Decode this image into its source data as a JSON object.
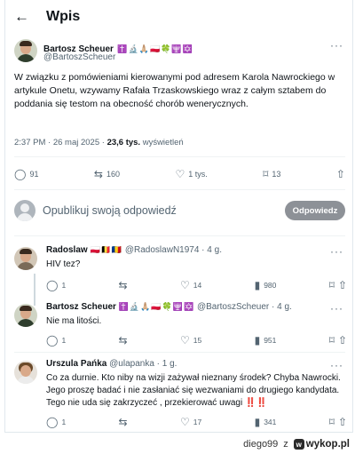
{
  "header": {
    "back_icon": "arrow-left-icon",
    "title": "Wpis"
  },
  "main_post": {
    "author_name": "Bartosz Scheuer",
    "author_emoji": "✝️🔬🙏🏼🇵🇱🍀🕎✡️",
    "author_handle": "@BartoszScheuer",
    "text": "W związku z pomówieniami kierowanymi pod adresem Karola Nawrockiego w artykule Onetu, wzywamy Rafała Trzaskowskiego wraz z całym sztabem do poddania się testom na obecność chorób wenerycznych.",
    "time": "2:37 PM · 26 maj 2025 · ",
    "views_count": "23,6 tys.",
    "views_label": " wyświetleń",
    "stats": {
      "replies": "91",
      "retweets": "160",
      "likes": "1 tys.",
      "bookmarks": "13"
    }
  },
  "reply_box": {
    "placeholder": "Opublikuj swoją odpowiedź",
    "button": "Odpowiedz"
  },
  "replies": [
    {
      "name": "Radoslaw",
      "emoji": "🇵🇱🇧🇪🇷🇴",
      "handle": "@RadoslawN1974 · 4 g.",
      "text": "HIV tez?",
      "replies": "1",
      "retweets": "",
      "likes": "14",
      "views": "980"
    },
    {
      "name": "Bartosz Scheuer",
      "emoji": "✝️🔬🙏🏼🇵🇱🍀🕎✡️",
      "handle": "@BartoszScheuer · 4 g.",
      "text": "Nie ma litości.",
      "replies": "1",
      "retweets": "",
      "likes": "15",
      "views": "951"
    },
    {
      "name": "Urszula Pańka",
      "emoji": "",
      "handle": "@ulapanka · 1 g.",
      "text": "Co za durnie. Kto niby na wizji zażywał nieznany środek? Chyba Nawrocki. Jego proszę badać i nie zasłaniać się wezwaniami do drugiego kandydata. Tego nie uda się zakrzyczeć , przekierować uwagi",
      "text_tail": "‼️‼️",
      "replies": "1",
      "retweets": "",
      "likes": "17",
      "views": "341"
    }
  ],
  "footer": {
    "user": "diego99",
    "z": "z",
    "site": "wykop.pl"
  },
  "colors": {
    "muted": "#536471",
    "border": "#e1e8ed",
    "button": "#8d9197"
  }
}
